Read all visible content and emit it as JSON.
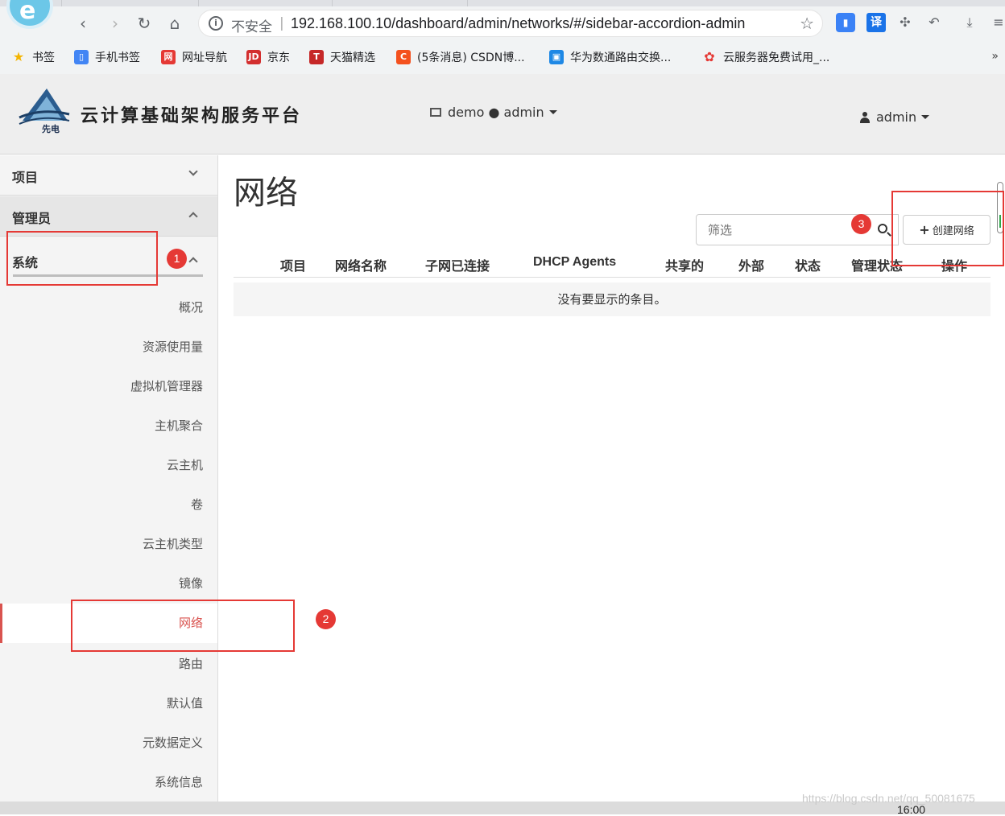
{
  "browser": {
    "url_security": "不安全",
    "url": "192.168.100.10/dashboard/admin/networks/#/sidebar-accordion-admin",
    "bookmarks": [
      {
        "label": "书签",
        "icon": "star-icon",
        "color": "#f4b400"
      },
      {
        "label": "手机书签",
        "icon": "phone-icon",
        "color": "#4285f4"
      },
      {
        "label": "网址导航",
        "icon": "nav-icon",
        "color": "#e53935"
      },
      {
        "label": "京东",
        "icon": "jd-icon",
        "color": "#d32f2f"
      },
      {
        "label": "天猫精选",
        "icon": "tmall-icon",
        "color": "#c62828"
      },
      {
        "label": "(5条消息) CSDN博...",
        "icon": "csdn-icon",
        "color": "#f4511e"
      },
      {
        "label": "华为数通路由交换...",
        "icon": "bilibili-icon",
        "color": "#1e88e5"
      },
      {
        "label": "云服务器免费试用_...",
        "icon": "huawei-icon",
        "color": "#e53935"
      }
    ],
    "bookmarks_more": "»"
  },
  "header": {
    "brand_logo_text": "先电",
    "brand_title": "云计算基础架构服务平台",
    "project_context": "demo ● admin",
    "user": "admin"
  },
  "sidebar": {
    "sections": [
      {
        "label": "项目",
        "state": "collapsed"
      },
      {
        "label": "管理员",
        "state": "expanded"
      },
      {
        "label": "系统",
        "state": "expanded"
      }
    ],
    "items": [
      "概况",
      "资源使用量",
      "虚拟机管理器",
      "主机聚合",
      "云主机",
      "卷",
      "云主机类型",
      "镜像",
      "网络",
      "路由",
      "默认值",
      "元数据定义",
      "系统信息"
    ],
    "active_item": "网络"
  },
  "main": {
    "title": "网络",
    "filter_placeholder": "筛选",
    "create_button": "创建网络",
    "columns": [
      "项目",
      "网络名称",
      "子网已连接",
      "DHCP Agents",
      "共享的",
      "外部",
      "状态",
      "管理状态",
      "操作"
    ],
    "empty_message": "没有要显示的条目。"
  },
  "annotations": {
    "badges": [
      "1",
      "2",
      "3"
    ],
    "color": "#e53935"
  },
  "footer": {
    "watermark": "https://blog.csdn.net/qq_50081675",
    "clock": "16:00"
  }
}
